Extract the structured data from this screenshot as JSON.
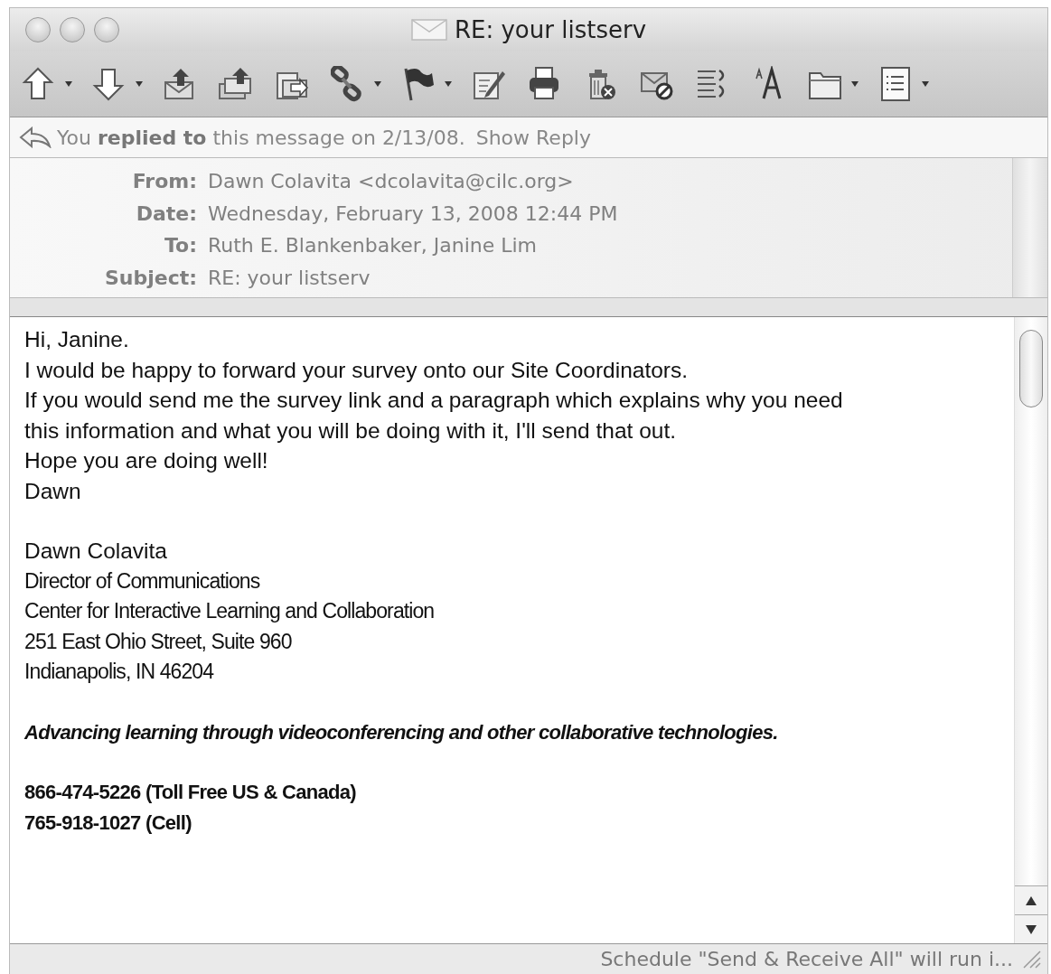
{
  "window": {
    "title": "RE: your listserv"
  },
  "toolbar": [
    {
      "menu": true
    },
    {
      "menu": true
    },
    {
      "menu": false
    },
    {
      "menu": false
    },
    {
      "menu": false
    },
    {
      "menu": true
    },
    {
      "menu": true
    },
    {
      "menu": false
    },
    {
      "menu": false
    },
    {
      "menu": false
    },
    {
      "menu": false
    },
    {
      "menu": false
    },
    {
      "menu": false
    },
    {
      "menu": true
    },
    {
      "menu": true
    }
  ],
  "reply_notice": {
    "text": "You **replied to** this message on 2/13/08.",
    "link": "Show Reply"
  },
  "headers": [
    {
      "label": "From:",
      "value": "Dawn Colavita <dcolavita@cilc.org>"
    },
    {
      "label": "Date:",
      "value": "Wednesday, February 13, 2008 12:44 PM"
    },
    {
      "label": "To:",
      "value": "Ruth E. Blankenbaker, Janine Lim"
    },
    {
      "label": "Subject:",
      "value": "RE: your listserv"
    }
  ],
  "body": {
    "blocks": [
      {
        "kind": "message",
        "lines": [
          "Hi, Janine.",
          "I would be happy to forward your survey onto our Site Coordinators.",
          "If you would send me the survey link and a paragraph which explains why you need",
          "this information and what you will be doing with it, I'll send that out.",
          "Hope you are doing well!",
          "Dawn"
        ]
      },
      {
        "kind": "name",
        "lines": [
          "Dawn Colavita"
        ]
      },
      {
        "kind": "contact",
        "lines": [
          "Director of Communications",
          "Center for Interactive Learning and Collaboration",
          "251 East Ohio Street, Suite 960",
          "Indianapolis, IN 46204"
        ]
      },
      {
        "kind": "tagline",
        "lines": [
          "Advancing learning through videoconferencing and other collaborative technologies."
        ]
      },
      {
        "kind": "phones",
        "lines": [
          "866-474-5226 (Toll Free US & Canada)",
          "765-918-1027 (Cell)"
        ]
      }
    ]
  },
  "status_bar": {
    "text": "Schedule \"Send & Receive All\" will run i..."
  }
}
